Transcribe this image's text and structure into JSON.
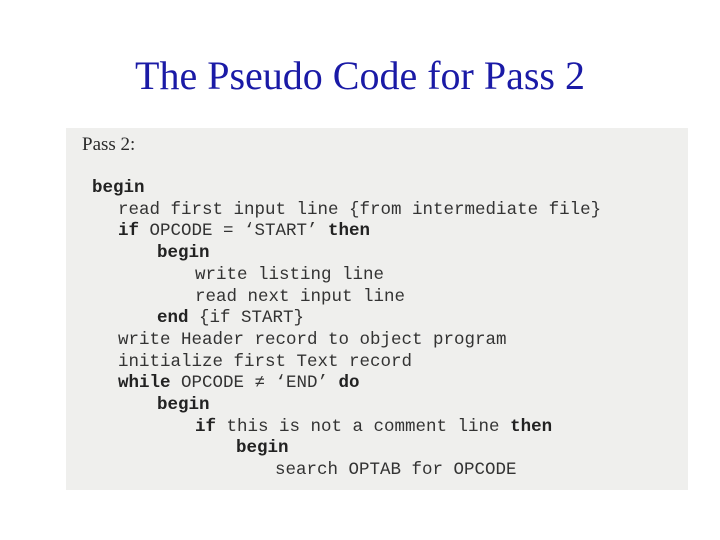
{
  "title": "The Pseudo Code for Pass 2",
  "scan": {
    "heading": "Pass 2:",
    "lines": [
      {
        "indent": 0,
        "segments": [
          {
            "t": "begin",
            "kw": true
          }
        ]
      },
      {
        "indent": 1,
        "segments": [
          {
            "t": "read first input line {from intermediate file}"
          }
        ]
      },
      {
        "indent": 1,
        "segments": [
          {
            "t": "if",
            "kw": true
          },
          {
            "t": " OPCODE = ‘START’ "
          },
          {
            "t": "then",
            "kw": true
          }
        ]
      },
      {
        "indent": 2,
        "segments": [
          {
            "t": "begin",
            "kw": true
          }
        ]
      },
      {
        "indent": 3,
        "segments": [
          {
            "t": "write listing line"
          }
        ]
      },
      {
        "indent": 3,
        "segments": [
          {
            "t": "read next input line"
          }
        ]
      },
      {
        "indent": 2,
        "segments": [
          {
            "t": "end",
            "kw": true
          },
          {
            "t": " {if START}"
          }
        ]
      },
      {
        "indent": 1,
        "segments": [
          {
            "t": "write Header record to object program"
          }
        ]
      },
      {
        "indent": 1,
        "segments": [
          {
            "t": "initialize first Text record"
          }
        ]
      },
      {
        "indent": 1,
        "segments": [
          {
            "t": "while",
            "kw": true
          },
          {
            "t": " OPCODE ≠ ‘END’ "
          },
          {
            "t": "do",
            "kw": true
          }
        ]
      },
      {
        "indent": 2,
        "segments": [
          {
            "t": "begin",
            "kw": true
          }
        ]
      },
      {
        "indent": 3,
        "segments": [
          {
            "t": "if",
            "kw": true
          },
          {
            "t": " this is not a comment line "
          },
          {
            "t": "then",
            "kw": true
          }
        ]
      },
      {
        "indent": 4,
        "segments": [
          {
            "t": "begin",
            "kw": true
          }
        ]
      },
      {
        "indent": 5,
        "segments": [
          {
            "t": "search OPTAB for OPCODE"
          }
        ]
      }
    ]
  }
}
